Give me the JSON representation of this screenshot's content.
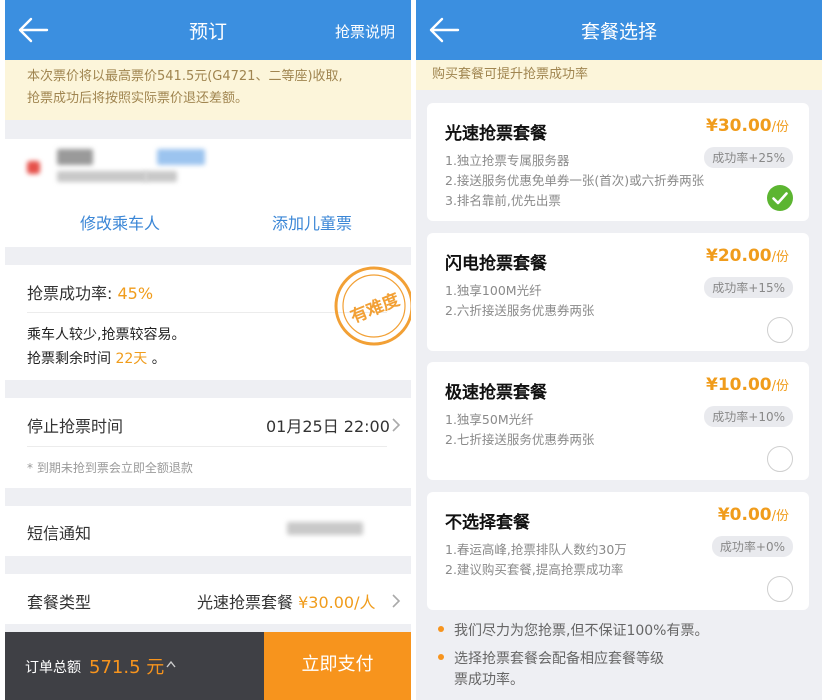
{
  "left": {
    "title": "预订",
    "header_right": "抢票说明",
    "notice_line1": "本次票价将以最高票价541.5元(G4721、二等座)收取,",
    "notice_line2": "抢票成功后将按照实际票价退还差额。",
    "modify_passenger": "修改乘车人",
    "add_child_ticket": "添加儿童票",
    "success_rate_label": "抢票成功率: ",
    "success_rate_value": "45%",
    "stamp_text": "有难度",
    "note_line1": "乘车人较少,抢票较容易。",
    "remaining_label": "抢票剩余时间 ",
    "remaining_value": "22天",
    "remaining_suffix": " 。",
    "stop_label": "停止抢票时间",
    "stop_value": "01月25日 22:00",
    "refund_note": "* 到期未抢到票会立即全额退款",
    "sms_label": "短信通知",
    "package_type_label": "套餐类型",
    "package_type_value": "光速抢票套餐",
    "package_type_price": "¥30.00/人",
    "total_label": "订单总额",
    "total_value": "571.5 元",
    "pay_button": "立即支付"
  },
  "right": {
    "title": "套餐选择",
    "notice": "购买套餐可提升抢票成功率",
    "packages": [
      {
        "name": "光速抢票套餐",
        "price": "¥30.00",
        "unit": "/份",
        "rate": "成功率+25%",
        "lines": [
          "1.独立抢票专属服务器",
          "2.接送服务优惠免单券一张(首次)或六折券两张",
          "3.排名靠前,优先出票"
        ],
        "selected": true
      },
      {
        "name": "闪电抢票套餐",
        "price": "¥20.00",
        "unit": "/份",
        "rate": "成功率+15%",
        "lines": [
          "1.独享100M光纤",
          "2.六折接送服务优惠券两张"
        ],
        "selected": false
      },
      {
        "name": "极速抢票套餐",
        "price": "¥10.00",
        "unit": "/份",
        "rate": "成功率+10%",
        "lines": [
          "1.独享50M光纤",
          "2.七折接送服务优惠券两张"
        ],
        "selected": false
      },
      {
        "name": "不选择套餐",
        "price": "¥0.00",
        "unit": "/份",
        "rate": "成功率+0%",
        "lines": [
          "1.春运高峰,抢票排队人数约30万",
          "2.建议购买套餐,提高抢票成功率"
        ],
        "selected": false
      }
    ],
    "bullet1": "我们尽力为您抢票,但不保证100%有票。",
    "bullet2_line1": "选择抢票套餐会配备相应套餐等级",
    "bullet2_line2": "票成功率。"
  },
  "colors": {
    "header_blue": "#3b8fe0",
    "accent_orange": "#f09c1c",
    "pay_orange": "#f7941d",
    "link_blue": "#3a86d6",
    "check_green": "#5cb531",
    "footer_dark": "#3f4045"
  },
  "icons": [
    "back-arrow-icon",
    "chevron-right-icon",
    "chevron-up-icon",
    "check-circle-icon",
    "radio-empty-icon"
  ]
}
